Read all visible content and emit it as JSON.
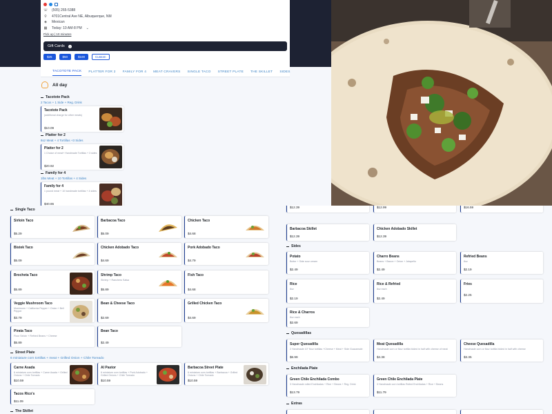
{
  "info": {
    "phone": "(505) 265-5388",
    "address": "4701Central Ave NE, Albuquerque, NM",
    "cuisine": "Mexican",
    "hours": "Today: 10 AM-8 PM",
    "pickup": "Pick up | 10 minutes"
  },
  "gift": {
    "label": "Gift Cards",
    "amounts": [
      "$25",
      "$50",
      "$100",
      "Custom"
    ]
  },
  "tabs": [
    "TACOTOTE PACK",
    "PLATTER FOR 2",
    "FAMILY FOR 4",
    "MEAT CRAVERS",
    "SINGLE TACO",
    "STREET PLATE",
    "THE SKILLET",
    "SIDES"
  ],
  "menu_title": "All day",
  "packs": [
    {
      "section": "Tacotote Pack",
      "sub": "2 Tacos + 1 Side + Reg. Drink",
      "name": "Tacotote Pack",
      "desc": "(additional charge for other meats)",
      "price": "$10.09"
    },
    {
      "section": "Platter for 2",
      "sub": "8oz Meat + 4 Tortillas +3 Sides",
      "name": "Platter for 2",
      "desc": "1 Choice of meat+ Handmade Tortillas + 3 sides",
      "price": "$20.92"
    },
    {
      "section": "Family for 4",
      "sub": "1lbs Meat + 10 Tortillas + 4 Sides",
      "name": "Family for 4",
      "desc": "1 pound meat + 10 handmade tortillas + 4 sides",
      "price": "$40.65"
    }
  ],
  "single_taco": {
    "title": "Single Taco",
    "items": [
      {
        "name": "Sirloin Taco",
        "desc": "",
        "price": "$5.29"
      },
      {
        "name": "Barbacoa Taco",
        "desc": "",
        "price": "$5.09"
      },
      {
        "name": "Chicken Taco",
        "desc": "",
        "price": "$4.68"
      },
      {
        "name": "Bistek Taco",
        "desc": "",
        "price": "$5.09"
      },
      {
        "name": "Chicken Adobado Taco",
        "desc": "",
        "price": "$4.69"
      },
      {
        "name": "Pork Adobado Taco",
        "desc": "",
        "price": "$4.79"
      },
      {
        "name": "Brocheta Taco",
        "desc": "",
        "price": "$5.89"
      },
      {
        "name": "Shrimp Taco",
        "desc": "Shrimp + Ranchero Salsa",
        "price": "$5.89"
      },
      {
        "name": "Fish Taco",
        "desc": "",
        "price": "$4.68"
      },
      {
        "name": "Veggie Mushroom Taco",
        "desc": "Mushroom + California Pepper + Onion + Bell Pepper",
        "price": "$3.79"
      },
      {
        "name": "Bean & Cheese Taco",
        "desc": "",
        "price": "$2.69"
      },
      {
        "name": "Grilled Chicken Taco",
        "desc": "",
        "price": "$4.69"
      },
      {
        "name": "Pirata Taco",
        "desc": "Flour Sirloin + Refried Beans + Cheese",
        "price": "$5.89"
      },
      {
        "name": "Bean Taco",
        "desc": "",
        "price": "$2.49"
      }
    ]
  },
  "street_plate": {
    "title": "Street Plate",
    "sub": "6 miniature corn tortillas + meat + Grilled Onion + Chile Toreado",
    "items": [
      {
        "name": "Carne Asada",
        "desc": "6 miniature corn tortillas + Carne Asada + Grilled Onions + Chile Toreado",
        "price": "$10.59"
      },
      {
        "name": "Al Pastor",
        "desc": "6 miniature corn tortillas + Pork Adobado + Grilled Onions + Chile Toreado",
        "price": "$10.59"
      },
      {
        "name": "Barbacoa Street Plate",
        "desc": "6 miniature corn tortillas + Barbacoa + Grilled Onions + Chile Toreado",
        "price": "$10.59"
      },
      {
        "name": "Tacos Rico's",
        "desc": "",
        "price": "$11.09"
      }
    ]
  },
  "skillet_title": "The Skillet",
  "right": {
    "top_prices": [
      "$12.39",
      "$12.99",
      "$16.59"
    ],
    "skillets": [
      {
        "name": "Barbacoa Skillet",
        "price": "$12.39"
      },
      {
        "name": "Chicken Adobado Skillet",
        "price": "$12.39"
      }
    ],
    "sides_title": "Sides",
    "sides": [
      {
        "name": "Potato",
        "desc": "Butter + Side sour cream",
        "price": "$2.49"
      },
      {
        "name": "Charro Beans",
        "desc": "Beans + Bacon + Onion + Jalapeño",
        "price": "$2.49"
      },
      {
        "name": "Refried Beans",
        "desc": "8oz",
        "price": "$2.19"
      },
      {
        "name": "Rice",
        "desc": "8oz",
        "price": "$2.19"
      },
      {
        "name": "Rice & Refried",
        "desc": "8oz each",
        "price": "$2.49"
      },
      {
        "name": "Fries",
        "desc": "",
        "price": "$2.25"
      },
      {
        "name": "Rice & Charros",
        "desc": "8oz each",
        "price": "$2.69"
      }
    ],
    "quesadillas_title": "Quesadillas",
    "quesadillas": [
      {
        "name": "Super Quesadilla",
        "desc": "2 Handmade 10\" flour tortillas +Cheese + Meat + Side Guacamole",
        "price": "$6.99"
      },
      {
        "name": "Meat Quesadilla",
        "desc": "Handmade corn or flour tortilla folded in half with cheese of meat",
        "price": "$4.38"
      },
      {
        "name": "Cheese Quesadilla",
        "desc": "Handmade corn or flour tortilla folded in half with cheese",
        "price": "$3.35"
      }
    ],
    "enchilada_title": "Enchilada Plate",
    "enchiladas": [
      {
        "name": "Green Chile Enchilada Combo",
        "desc": "3 Handmade rolled Enchiladas + Rice + Beans + Reg. Drink",
        "price": "$13.79"
      },
      {
        "name": "Green Chile Enchilada Plate",
        "desc": "3 Handmade corn tortillas Rolled Enchiladas + Rice + Beans",
        "price": "$11.79"
      }
    ],
    "extras_title": "Extras"
  },
  "colors": {
    "accent": "#1a56db",
    "dark": "#1d2233",
    "link": "#3b82c4"
  }
}
